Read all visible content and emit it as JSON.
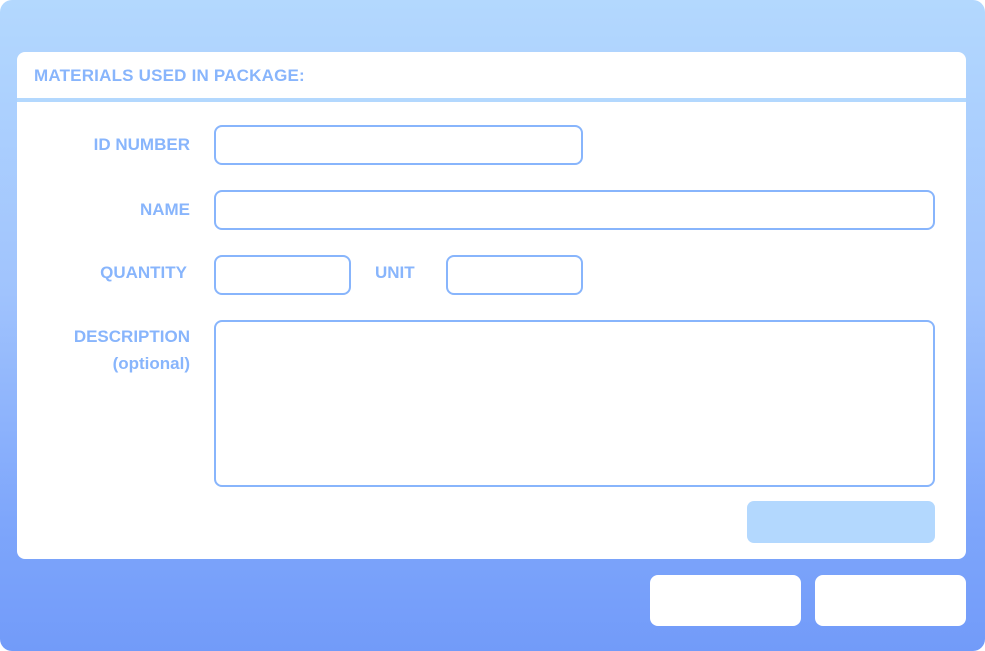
{
  "panel": {
    "title": "MATERIALS USED IN PACKAGE:"
  },
  "form": {
    "id_number": {
      "label": "ID NUMBER",
      "value": ""
    },
    "name": {
      "label": "NAME",
      "value": ""
    },
    "quantity": {
      "label": "QUANTITY",
      "value": ""
    },
    "unit": {
      "label": "UNIT",
      "value": ""
    },
    "description": {
      "label_line1": "DESCRIPTION",
      "label_line2": "(optional)",
      "value": ""
    }
  },
  "buttons": {
    "submit_label": "",
    "footer_left_label": "",
    "footer_right_label": ""
  },
  "colors": {
    "label": "#88b5fc",
    "border": "#88b5fc",
    "header_line": "#b3d8fe",
    "submit_bg": "#b3d8fe"
  }
}
